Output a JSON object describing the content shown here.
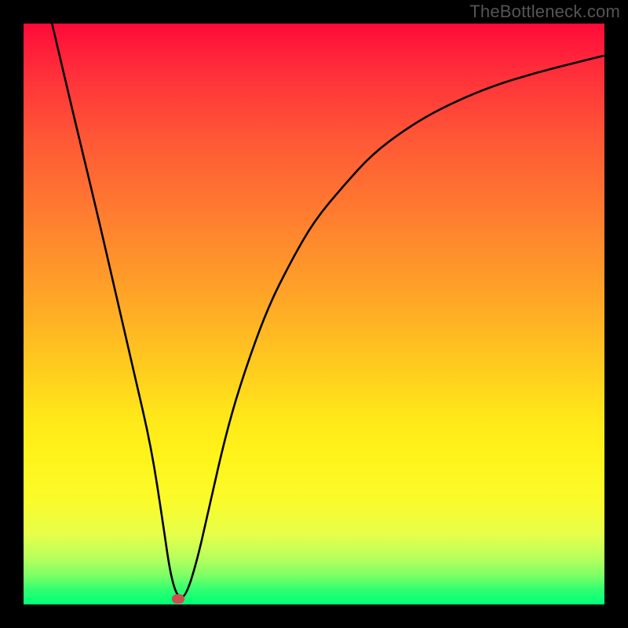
{
  "watermark": "TheBottleneck.com",
  "colors": {
    "frame_bg": "#000000",
    "curve_stroke": "#000000",
    "marker_fill": "#cc4e4e",
    "gradient_top": "#ff0a3a",
    "gradient_bottom": "#00ff78"
  },
  "chart_data": {
    "type": "line",
    "title": "",
    "xlabel": "",
    "ylabel": "",
    "xlim": [
      0,
      100
    ],
    "ylim": [
      0,
      100
    ],
    "notes": "Unlabeled bottleneck-style curve on a vertical red→green gradient. y-axis inverted visually (0 at bottom, gradient shows green near 0). Values estimated from pixel positions.",
    "series": [
      {
        "name": "curve",
        "x": [
          4.9,
          7,
          10,
          13,
          16,
          19,
          22,
          24,
          25.3,
          26.6,
          28,
          30,
          32,
          35,
          38,
          42,
          46,
          50,
          55,
          60,
          66,
          72,
          80,
          88,
          96,
          100
        ],
        "values": [
          100,
          91,
          78.5,
          66,
          53,
          40,
          27,
          14,
          5,
          1,
          1.5,
          8,
          17,
          30,
          40,
          51,
          59,
          66,
          72,
          77.5,
          82,
          85.5,
          89,
          91.5,
          93.5,
          94.5
        ]
      }
    ],
    "marker": {
      "x": 26.6,
      "y": 1
    }
  }
}
